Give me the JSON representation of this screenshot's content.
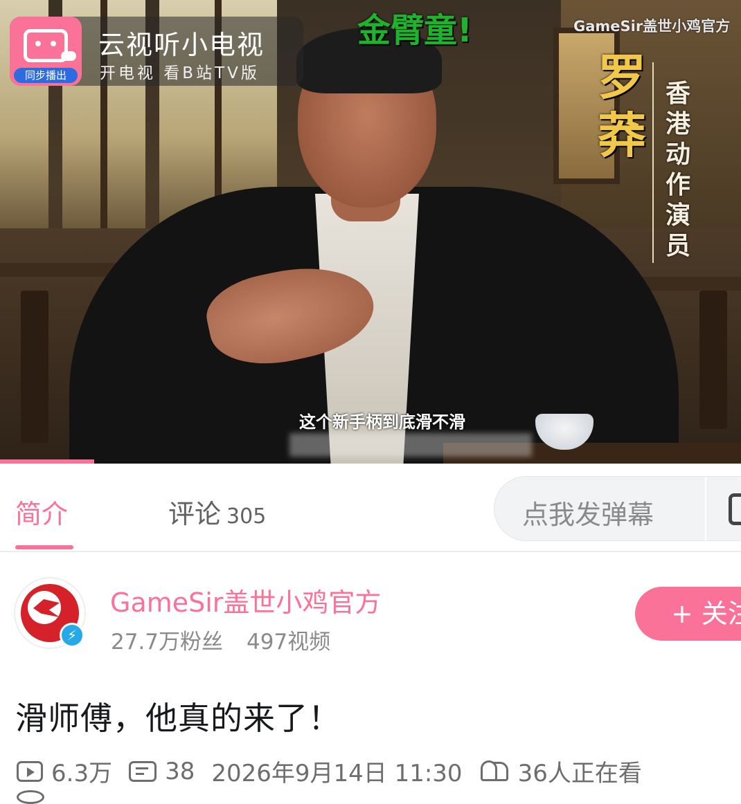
{
  "video": {
    "brand_title": "云视听小电视",
    "brand_subtitle": "开电视 看B站TV版",
    "brand_tag": "同步播出",
    "top_caption": "金臂童!",
    "watermark": "GameSir盖世小鸡官方",
    "person_name": "罗莽",
    "person_role": "香港动作演员",
    "subtitle": "这个新手柄到底滑不滑",
    "progress_fraction": 0.127
  },
  "tabs": {
    "intro_label": "简介",
    "comment_label": "评论",
    "comment_count": "305",
    "danmaku_placeholder": "点我发弹幕"
  },
  "uploader": {
    "name": "GameSir盖世小鸡官方",
    "fans": "27.7万粉丝",
    "videos": "497视频",
    "follow_label": "+ 关注",
    "verified_mark": "⚡"
  },
  "video_info": {
    "title": "滑师傅，他真的来了！",
    "views": "6.3万",
    "danmaku_count": "38",
    "publish_time": "2026年9月14日 11:30",
    "watching": "36人正在看"
  },
  "colors": {
    "accent": "#fb7299",
    "caption_green": "#1fb32d",
    "name_gold": "#f2c84b",
    "verified_blue": "#27a8e8"
  }
}
